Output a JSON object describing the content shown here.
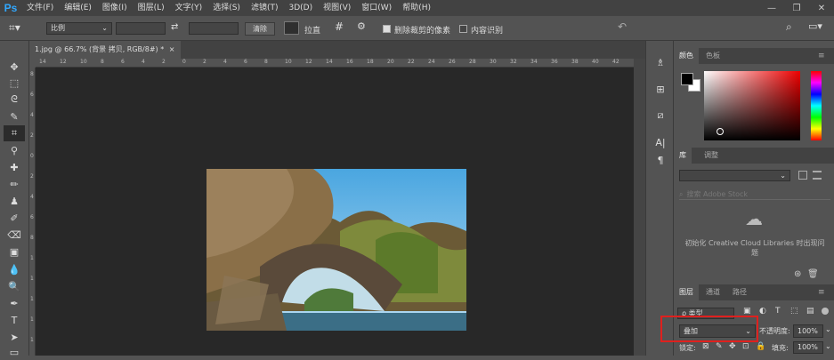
{
  "app": {
    "logo": "Ps"
  },
  "menu": [
    "文件(F)",
    "编辑(E)",
    "图像(I)",
    "图层(L)",
    "文字(Y)",
    "选择(S)",
    "滤镜(T)",
    "3D(D)",
    "视图(V)",
    "窗口(W)",
    "帮助(H)"
  ],
  "window_controls": {
    "minimize": "—",
    "restore": "❐",
    "close": "✕"
  },
  "options": {
    "ratio_select": "比例",
    "clear_button": "清除",
    "straighten_label": "拉直",
    "delete_cropped": {
      "label": "删除裁剪的像素",
      "checked": true
    },
    "content_aware": {
      "label": "内容识别",
      "checked": false
    }
  },
  "document_tab": {
    "title": "1.jpg @ 66.7% (背景 拷贝, RGB/8#) *",
    "close": "×"
  },
  "ruler": {
    "h_ticks": [
      "14",
      "12",
      "10",
      "8",
      "6",
      "4",
      "2",
      "0",
      "2",
      "4",
      "6",
      "8",
      "10",
      "12",
      "14",
      "16",
      "18",
      "20",
      "22",
      "24",
      "26",
      "28",
      "30",
      "32",
      "34",
      "36",
      "38",
      "40",
      "42"
    ],
    "v_ticks": [
      "8",
      "6",
      "4",
      "2",
      "0",
      "2",
      "4",
      "6",
      "8",
      "1",
      "1",
      "1",
      "1",
      "1"
    ]
  },
  "color_panel": {
    "tabs": [
      "颜色",
      "色板"
    ],
    "foreground": "#000000",
    "background": "#ffffff"
  },
  "libraries_panel": {
    "tabs": [
      "库",
      "调整"
    ],
    "search_placeholder": "搜索 Adobe Stock",
    "message": "初始化 Creative Cloud Libraries 时出现问题"
  },
  "layers_panel": {
    "tabs": [
      "图层",
      "通道",
      "路径"
    ],
    "filter_kind": "ρ 类型",
    "blend_mode": "叠加",
    "opacity_label": "不透明度:",
    "opacity_value": "100%",
    "lock_label": "锁定:",
    "fill_label": "填充:",
    "fill_value": "100%"
  },
  "colors": {
    "highlight": "#e0201e",
    "accent": "#31a8ff"
  }
}
